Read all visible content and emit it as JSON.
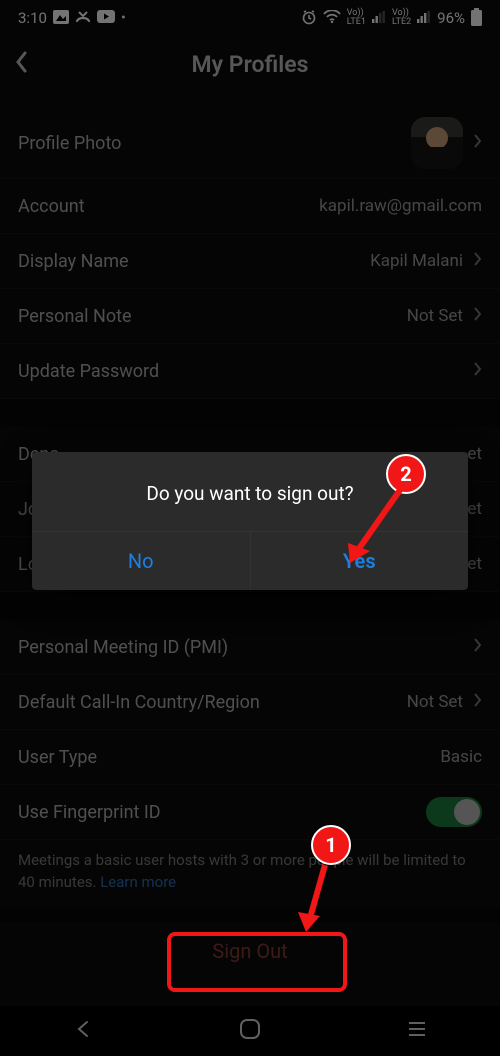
{
  "status": {
    "time": "3:10",
    "battery": "96%",
    "lte1": "LTE1",
    "lte2": "LTE2",
    "vo": "Vo))"
  },
  "header": {
    "title": "My Profiles"
  },
  "rows": {
    "profile_photo": "Profile Photo",
    "account_label": "Account",
    "account_value": "kapil.raw@gmail.com",
    "display_name_label": "Display Name",
    "display_name_value": "Kapil Malani",
    "personal_note_label": "Personal Note",
    "personal_note_value": "Not Set",
    "update_password": "Update Password",
    "department_label": "Depa",
    "department_value": "et",
    "job_label": "Job",
    "job_value": "et",
    "location_label": "Loca",
    "location_value": "et",
    "pmi": "Personal Meeting ID (PMI)",
    "callin_label": "Default Call-In Country/Region",
    "callin_value": "Not Set",
    "user_type_label": "User Type",
    "user_type_value": "Basic",
    "fingerprint": "Use Fingerprint ID"
  },
  "footer": {
    "note_a": "Meetings a basic user hosts with 3 or more people will be limited to 40 minutes. ",
    "note_link": "Learn more",
    "sign_out": "Sign Out"
  },
  "dialog": {
    "message": "Do you want to sign out?",
    "no": "No",
    "yes": "Yes"
  },
  "annotations": {
    "one": "1",
    "two": "2"
  }
}
